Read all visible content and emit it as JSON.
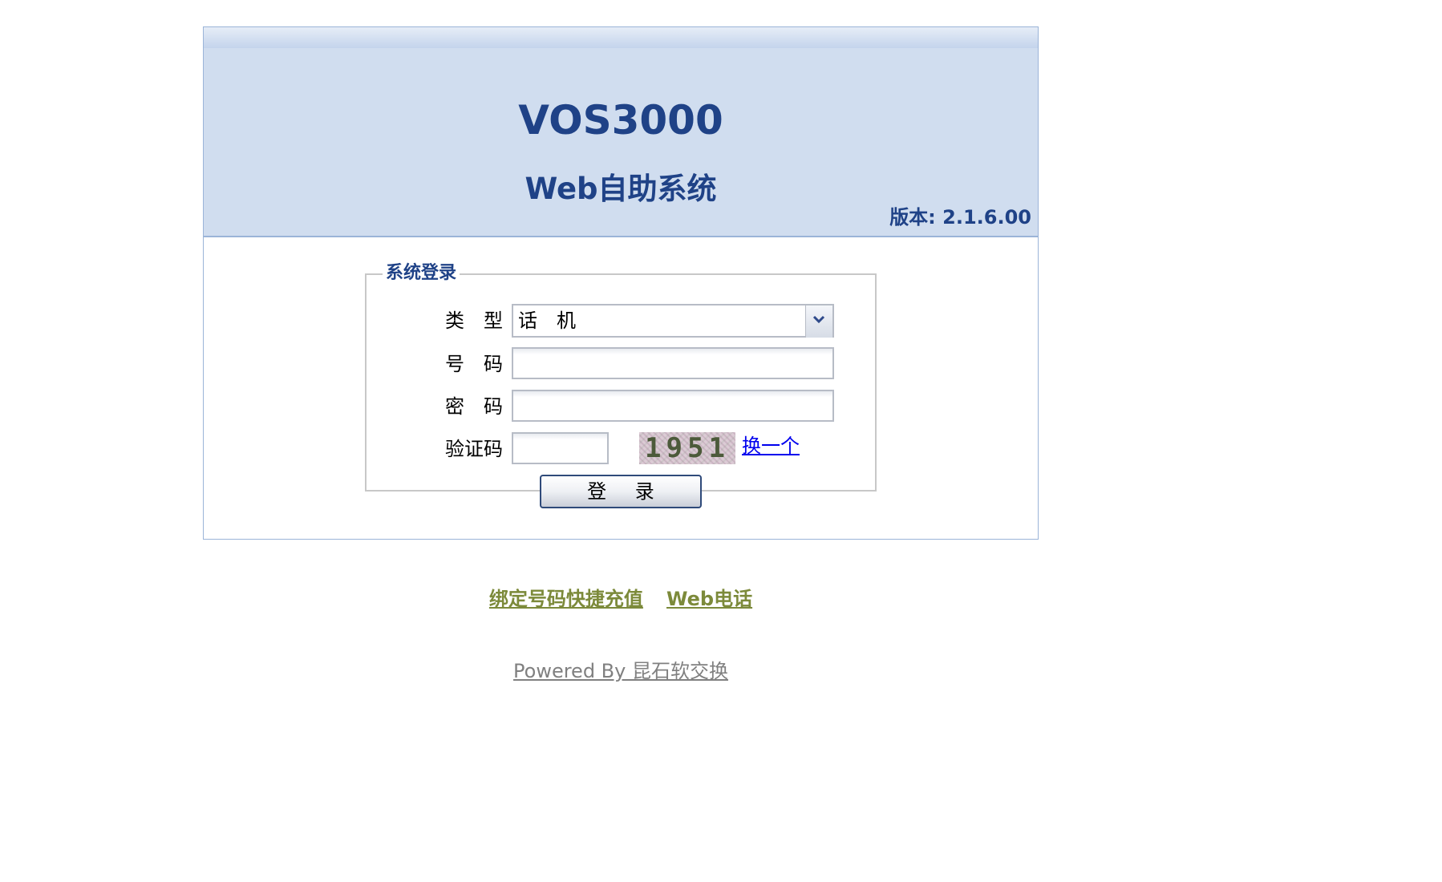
{
  "header": {
    "title": "VOS3000",
    "subtitle": "Web自助系统",
    "version": "版本: 2.1.6.00",
    "bg_color": "#d0ddef",
    "title_color": "#1f4287"
  },
  "login": {
    "legend": "系统登录",
    "type_label": "类　型",
    "type_value": "话　机",
    "number_label": "号　码",
    "number_value": "",
    "password_label": "密　码",
    "password_value": "",
    "captcha_label": "验证码",
    "captcha_value": "",
    "captcha_image_text": "1951",
    "refresh_link": "换一个",
    "submit_label": "登 录"
  },
  "links": {
    "bind_recharge": "绑定号码快捷充值",
    "web_phone": "Web电话",
    "link_color": "#7c8a3a"
  },
  "footer": {
    "powered_by": "Powered By 昆石软交换"
  },
  "icons": {
    "select_arrow": "chevron-down-icon"
  }
}
